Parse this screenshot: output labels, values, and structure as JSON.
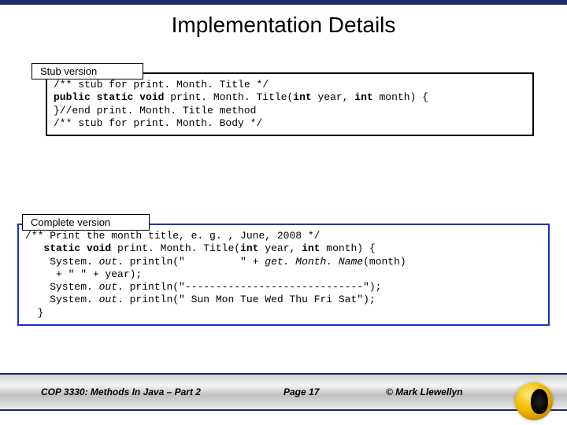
{
  "title": "Implementation Details",
  "labels": {
    "stub": "Stub version",
    "complete": "Complete version"
  },
  "code": {
    "stub": {
      "l1a": "/** stub for print. Month. Title */",
      "l2a": "public static void",
      "l2b": " print. Month. Title(",
      "l2c": "int",
      "l2d": " year, ",
      "l2e": "int",
      "l2f": " month) {",
      "l3a": "}//end print. Month. Title method",
      "l4a": "/** stub for print. Month. Body */"
    },
    "complete": {
      "l1": "/** Print the month title, e. g. , June, 2008 */",
      "l2a": "static void",
      "l2b": " print. Month. Title(",
      "l2c": "int",
      "l2d": " year, ",
      "l2e": "int",
      "l2f": " month) {",
      "l3a": "    System. ",
      "l3b": "out",
      "l3c": ". println(\"         \" + ",
      "l3d": "get. Month. Name",
      "l3e": "(month)",
      "l4": "     + \" \" + year);",
      "l5a": "    System. ",
      "l5b": "out",
      "l5c": ". println(\"-----------------------------\");",
      "l6a": "    System. ",
      "l6b": "out",
      "l6c": ". println(\" Sun Mon Tue Wed Thu Fri Sat\");",
      "l7": "  }"
    }
  },
  "footer": {
    "course": "COP 3330: Methods In Java – Part 2",
    "page": "Page 17",
    "copyright": "© Mark Llewellyn"
  }
}
